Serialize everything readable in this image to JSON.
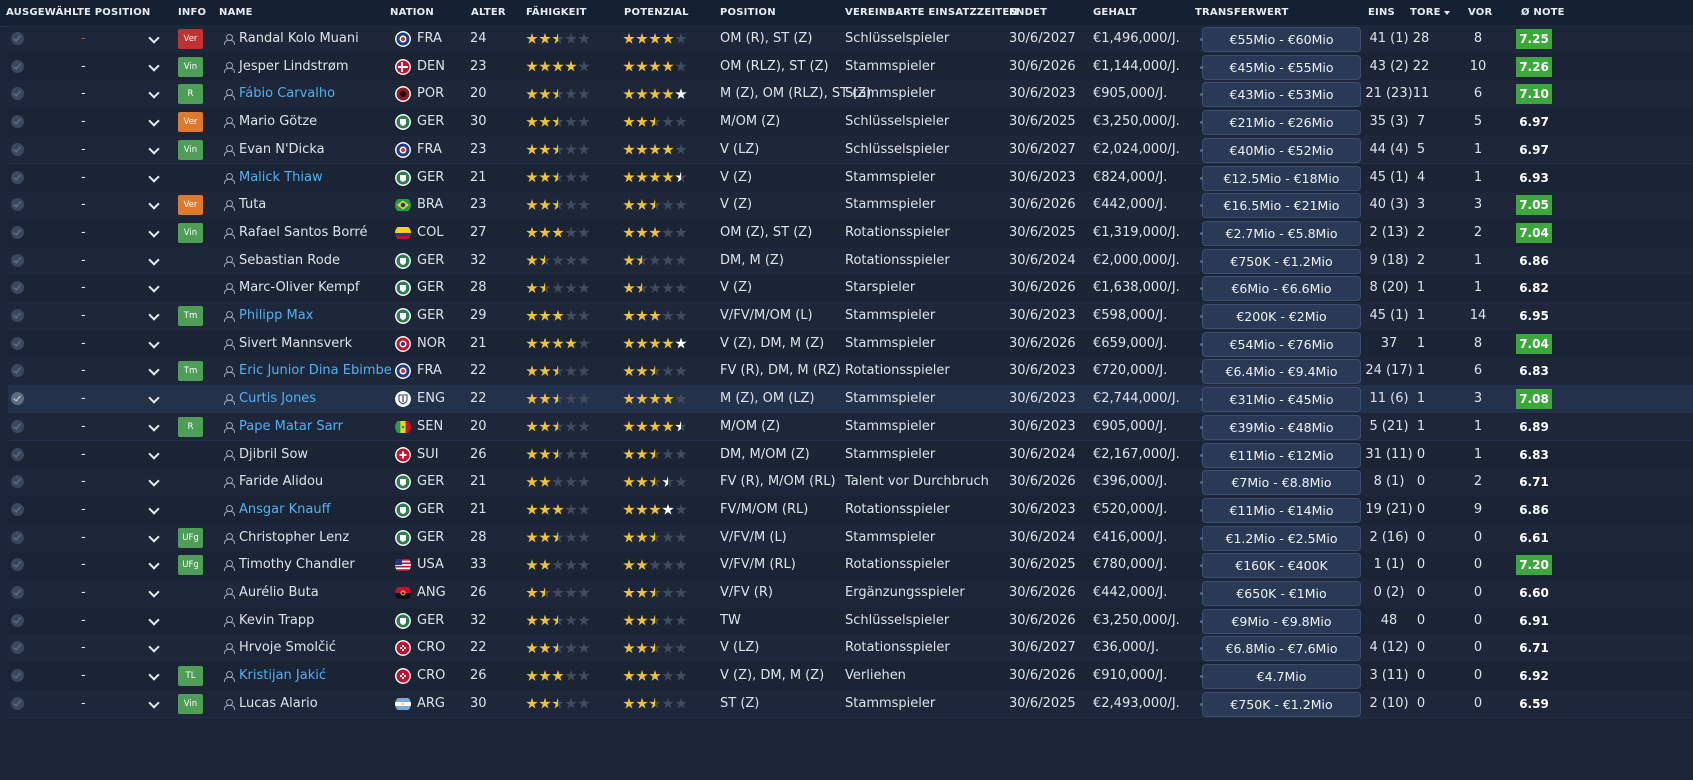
{
  "headers": {
    "sel_pos": "AUSGEWÄHLTE POSITION",
    "info": "INFO",
    "name": "NAME",
    "nation": "NATION",
    "age": "ALTER",
    "ability": "FÄHIGKEIT",
    "potential": "POTENZIAL",
    "position": "POSITION",
    "playing_time": "VEREINBARTE EINSATZZEITEN",
    "ends": "ENDET",
    "salary": "GEHALT",
    "transfer": "TRANSFERWERT",
    "apps": "EINS",
    "goals": "TORE",
    "assists": "VOR",
    "rating": "Ø NOTE"
  },
  "colors": {
    "badge_ver_red": "#c0312f",
    "badge_ver_orange": "#de7a2e",
    "badge_green": "#4f9e58",
    "note_green": "#3ca83c",
    "link": "#4fb2f0"
  },
  "players": [
    {
      "dash": "-",
      "dash_color": "red",
      "badge": "Ver",
      "badge_color": "#c0312f",
      "name": "Randal Kolo Muani",
      "link": false,
      "nation": "FRA",
      "age": "24",
      "ability": [
        2,
        2,
        1,
        0,
        0
      ],
      "potential": [
        2,
        2,
        2,
        2,
        0
      ],
      "position": "OM (R), ST (Z)",
      "playing": "Schlüsselspieler",
      "ends": "30/6/2027",
      "salary": "€1,496,000/J.",
      "transfer": "€55Mio - €60Mio",
      "apps": "41 (1)",
      "goals": "28",
      "assists": "8",
      "note": "7.25",
      "note_green": true
    },
    {
      "dash": "-",
      "badge": "Vin",
      "badge_color": "#4f9e58",
      "name": "Jesper Lindstrøm",
      "link": false,
      "nation": "DEN",
      "age": "23",
      "ability": [
        2,
        2,
        2,
        2,
        0
      ],
      "potential": [
        2,
        2,
        2,
        2,
        0
      ],
      "position": "OM (RLZ), ST (Z)",
      "playing": "Stammspieler",
      "ends": "30/6/2026",
      "salary": "€1,144,000/J.",
      "transfer": "€45Mio - €55Mio",
      "apps": "43 (2)",
      "goals": "22",
      "assists": "10",
      "note": "7.26",
      "note_green": true
    },
    {
      "dash": "-",
      "badge": "R",
      "badge_color": "#4f9e58",
      "name": "Fábio Carvalho",
      "link": true,
      "nation": "POR",
      "age": "20",
      "ability": [
        2,
        2,
        1,
        0,
        0
      ],
      "potential": [
        2,
        2,
        2,
        2,
        3
      ],
      "position": "M (Z), OM (RLZ), ST (Z)",
      "playing": "Stammspieler",
      "ends": "30/6/2023",
      "salary": "€905,000/J.",
      "transfer": "€43Mio - €53Mio",
      "apps": "21 (23)",
      "goals": "11",
      "assists": "6",
      "note": "7.10",
      "note_green": true
    },
    {
      "dash": "-",
      "badge": "Ver",
      "badge_color": "#de7a2e",
      "name": "Mario Götze",
      "link": false,
      "nation": "GER",
      "age": "30",
      "ability": [
        2,
        2,
        1,
        0,
        0
      ],
      "potential": [
        2,
        2,
        1,
        0,
        0
      ],
      "position": "M/OM (Z)",
      "playing": "Schlüsselspieler",
      "ends": "30/6/2025",
      "salary": "€3,250,000/J.",
      "transfer": "€21Mio - €26Mio",
      "apps": "35 (3)",
      "goals": "7",
      "assists": "5",
      "note": "6.97",
      "note_green": false
    },
    {
      "dash": "-",
      "badge": "Vin",
      "badge_color": "#4f9e58",
      "name": "Evan N'Dicka",
      "link": false,
      "nation": "FRA",
      "age": "23",
      "ability": [
        2,
        2,
        1,
        0,
        0
      ],
      "potential": [
        2,
        2,
        2,
        2,
        0
      ],
      "position": "V (LZ)",
      "playing": "Schlüsselspieler",
      "ends": "30/6/2027",
      "salary": "€2,024,000/J.",
      "transfer": "€40Mio - €52Mio",
      "apps": "44 (4)",
      "goals": "5",
      "assists": "1",
      "note": "6.97",
      "note_green": false
    },
    {
      "dash": "-",
      "badge": "",
      "name": "Malick Thiaw",
      "link": true,
      "nation": "GER",
      "age": "21",
      "ability": [
        2,
        2,
        1,
        0,
        0
      ],
      "potential": [
        2,
        2,
        2,
        2,
        4
      ],
      "position": "V (Z)",
      "playing": "Stammspieler",
      "ends": "30/6/2023",
      "salary": "€824,000/J.",
      "transfer": "€12.5Mio - €18Mio",
      "apps": "45 (1)",
      "goals": "4",
      "assists": "1",
      "note": "6.93",
      "note_green": false
    },
    {
      "dash": "-",
      "badge": "Ver",
      "badge_color": "#de7a2e",
      "name": "Tuta",
      "link": false,
      "nation": "BRA",
      "age": "23",
      "ability": [
        2,
        2,
        1,
        0,
        0
      ],
      "potential": [
        2,
        2,
        1,
        0,
        0
      ],
      "position": "V (Z)",
      "playing": "Stammspieler",
      "ends": "30/6/2026",
      "salary": "€442,000/J.",
      "transfer": "€16.5Mio - €21Mio",
      "apps": "40 (3)",
      "goals": "3",
      "assists": "3",
      "note": "7.05",
      "note_green": true
    },
    {
      "dash": "-",
      "badge": "Vin",
      "badge_color": "#4f9e58",
      "name": "Rafael Santos Borré",
      "link": false,
      "nation": "COL",
      "age": "27",
      "ability": [
        2,
        2,
        2,
        0,
        0
      ],
      "potential": [
        2,
        2,
        2,
        0,
        0
      ],
      "position": "OM (Z), ST (Z)",
      "playing": "Rotationsspieler",
      "ends": "30/6/2025",
      "salary": "€1,319,000/J.",
      "transfer": "€2.7Mio - €5.8Mio",
      "apps": "2 (13)",
      "goals": "2",
      "assists": "2",
      "note": "7.04",
      "note_green": true
    },
    {
      "dash": "-",
      "badge": "",
      "name": "Sebastian Rode",
      "link": false,
      "nation": "GER",
      "age": "32",
      "ability": [
        2,
        1,
        0,
        0,
        0
      ],
      "potential": [
        2,
        1,
        0,
        0,
        0
      ],
      "position": "DM, M (Z)",
      "playing": "Rotationsspieler",
      "ends": "30/6/2024",
      "salary": "€2,000,000/J.",
      "transfer": "€750K - €1.2Mio",
      "apps": "9 (18)",
      "goals": "2",
      "assists": "1",
      "note": "6.86",
      "note_green": false
    },
    {
      "dash": "-",
      "badge": "",
      "name": "Marc-Oliver Kempf",
      "link": false,
      "nation": "GER",
      "age": "28",
      "ability": [
        2,
        1,
        0,
        0,
        0
      ],
      "potential": [
        2,
        1,
        0,
        0,
        0
      ],
      "position": "V (Z)",
      "playing": "Starspieler",
      "ends": "30/6/2026",
      "salary": "€1,638,000/J.",
      "transfer": "€6Mio - €6.6Mio",
      "apps": "8 (20)",
      "goals": "1",
      "assists": "1",
      "note": "6.82",
      "note_green": false
    },
    {
      "dash": "-",
      "badge": "Tm",
      "badge_color": "#4f9e58",
      "name": "Philipp Max",
      "link": true,
      "nation": "GER",
      "age": "29",
      "ability": [
        2,
        2,
        2,
        0,
        0
      ],
      "potential": [
        2,
        2,
        2,
        0,
        0
      ],
      "position": "V/FV/M/OM (L)",
      "playing": "Stammspieler",
      "ends": "30/6/2023",
      "salary": "€598,000/J.",
      "transfer": "€200K - €2Mio",
      "apps": "45 (1)",
      "goals": "1",
      "assists": "14",
      "note": "6.95",
      "note_green": false
    },
    {
      "dash": "-",
      "badge": "",
      "name": "Sivert Mannsverk",
      "link": false,
      "nation": "NOR",
      "age": "21",
      "ability": [
        2,
        2,
        2,
        2,
        0
      ],
      "potential": [
        2,
        2,
        2,
        2,
        3
      ],
      "position": "V (Z), DM, M (Z)",
      "playing": "Stammspieler",
      "ends": "30/6/2026",
      "salary": "€659,000/J.",
      "transfer": "€54Mio - €76Mio",
      "apps": "37",
      "goals": "1",
      "assists": "8",
      "note": "7.04",
      "note_green": true
    },
    {
      "dash": "-",
      "badge": "Tm",
      "badge_color": "#4f9e58",
      "name": "Eric Junior Dina Ebimbe",
      "link": true,
      "nation": "FRA",
      "age": "22",
      "ability": [
        2,
        2,
        1,
        0,
        0
      ],
      "potential": [
        2,
        2,
        1,
        0,
        0
      ],
      "position": "FV (R), DM, M (RZ)",
      "playing": "Rotationsspieler",
      "ends": "30/6/2023",
      "salary": "€720,000/J.",
      "transfer": "€6.4Mio - €9.4Mio",
      "apps": "24 (17)",
      "goals": "1",
      "assists": "6",
      "note": "6.83",
      "note_green": false
    },
    {
      "dash": "-",
      "badge": "",
      "name": "Curtis Jones",
      "link": true,
      "selected": true,
      "nation": "ENG",
      "age": "22",
      "ability": [
        2,
        2,
        1,
        0,
        0
      ],
      "potential": [
        2,
        2,
        2,
        2,
        0
      ],
      "position": "M (Z), OM (LZ)",
      "playing": "Stammspieler",
      "ends": "30/6/2023",
      "salary": "€2,744,000/J.",
      "transfer": "€31Mio - €45Mio",
      "apps": "11 (6)",
      "goals": "1",
      "assists": "3",
      "note": "7.08",
      "note_green": true
    },
    {
      "dash": "-",
      "badge": "R",
      "badge_color": "#4f9e58",
      "name": "Pape Matar Sarr",
      "link": true,
      "nation": "SEN",
      "age": "20",
      "ability": [
        2,
        2,
        1,
        0,
        0
      ],
      "potential": [
        2,
        2,
        2,
        2,
        4
      ],
      "position": "M/OM (Z)",
      "playing": "Stammspieler",
      "ends": "30/6/2023",
      "salary": "€905,000/J.",
      "transfer": "€39Mio - €48Mio",
      "apps": "5 (21)",
      "goals": "1",
      "assists": "1",
      "note": "6.89",
      "note_green": false
    },
    {
      "dash": "-",
      "badge": "",
      "name": "Djibril Sow",
      "link": false,
      "nation": "SUI",
      "age": "26",
      "ability": [
        2,
        2,
        1,
        0,
        0
      ],
      "potential": [
        2,
        2,
        1,
        0,
        0
      ],
      "position": "DM, M/OM (Z)",
      "playing": "Stammspieler",
      "ends": "30/6/2024",
      "salary": "€2,167,000/J.",
      "transfer": "€11Mio - €12Mio",
      "apps": "31 (11)",
      "goals": "0",
      "assists": "1",
      "note": "6.83",
      "note_green": false
    },
    {
      "dash": "-",
      "badge": "",
      "name": "Faride Alidou",
      "link": false,
      "nation": "GER",
      "age": "21",
      "ability": [
        2,
        2,
        0,
        0,
        0
      ],
      "potential": [
        2,
        2,
        1,
        4,
        0
      ],
      "position": "FV (R), M/OM (RL)",
      "playing": "Talent vor Durchbruch",
      "ends": "30/6/2026",
      "salary": "€396,000/J.",
      "transfer": "€7Mio - €8.8Mio",
      "apps": "8 (1)",
      "goals": "0",
      "assists": "2",
      "note": "6.71",
      "note_green": false
    },
    {
      "dash": "-",
      "badge": "",
      "name": "Ansgar Knauff",
      "link": true,
      "nation": "GER",
      "age": "21",
      "ability": [
        2,
        2,
        2,
        0,
        0
      ],
      "potential": [
        2,
        2,
        2,
        3,
        0
      ],
      "position": "FV/M/OM (RL)",
      "playing": "Rotationsspieler",
      "ends": "30/6/2023",
      "salary": "€520,000/J.",
      "transfer": "€11Mio - €14Mio",
      "apps": "19 (21)",
      "goals": "0",
      "assists": "9",
      "note": "6.86",
      "note_green": false
    },
    {
      "dash": "-",
      "badge": "UFg",
      "badge_color": "#4f9e58",
      "name": "Christopher Lenz",
      "link": false,
      "nation": "GER",
      "age": "28",
      "ability": [
        2,
        2,
        1,
        0,
        0
      ],
      "potential": [
        2,
        2,
        1,
        0,
        0
      ],
      "position": "V/FV/M (L)",
      "playing": "Stammspieler",
      "ends": "30/6/2024",
      "salary": "€416,000/J.",
      "transfer": "€1.2Mio - €2.5Mio",
      "apps": "2 (16)",
      "goals": "0",
      "assists": "0",
      "note": "6.61",
      "note_green": false
    },
    {
      "dash": "-",
      "badge": "UFg",
      "badge_color": "#4f9e58",
      "name": "Timothy Chandler",
      "link": false,
      "nation": "USA",
      "age": "33",
      "ability": [
        2,
        2,
        0,
        0,
        0
      ],
      "potential": [
        2,
        2,
        0,
        0,
        0
      ],
      "position": "V/FV/M (RL)",
      "playing": "Rotationsspieler",
      "ends": "30/6/2025",
      "salary": "€780,000/J.",
      "transfer": "€160K - €400K",
      "apps": "1 (1)",
      "goals": "0",
      "assists": "0",
      "note": "7.20",
      "note_green": true
    },
    {
      "dash": "-",
      "badge": "",
      "name": "Aurélio Buta",
      "link": false,
      "nation": "ANG",
      "age": "26",
      "ability": [
        2,
        1,
        0,
        0,
        0
      ],
      "potential": [
        2,
        2,
        1,
        0,
        0
      ],
      "position": "V/FV (R)",
      "playing": "Ergänzungsspieler",
      "ends": "30/6/2026",
      "salary": "€442,000/J.",
      "transfer": "€650K - €1Mio",
      "apps": "0 (2)",
      "goals": "0",
      "assists": "0",
      "note": "6.60",
      "note_green": false
    },
    {
      "dash": "-",
      "badge": "",
      "name": "Kevin Trapp",
      "link": false,
      "nation": "GER",
      "age": "32",
      "ability": [
        2,
        2,
        1,
        0,
        0
      ],
      "potential": [
        2,
        2,
        1,
        0,
        0
      ],
      "position": "TW",
      "playing": "Schlüsselspieler",
      "ends": "30/6/2026",
      "salary": "€3,250,000/J.",
      "transfer": "€9Mio - €9.8Mio",
      "apps": "48",
      "goals": "0",
      "assists": "0",
      "note": "6.91",
      "note_green": false
    },
    {
      "dash": "-",
      "badge": "",
      "name": "Hrvoje Smolčić",
      "link": false,
      "nation": "CRO",
      "age": "22",
      "ability": [
        2,
        2,
        1,
        0,
        0
      ],
      "potential": [
        2,
        2,
        1,
        0,
        0
      ],
      "position": "V (LZ)",
      "playing": "Rotationsspieler",
      "ends": "30/6/2027",
      "salary": "€36,000/J.",
      "transfer": "€6.8Mio - €7.6Mio",
      "apps": "4 (12)",
      "goals": "0",
      "assists": "0",
      "note": "6.71",
      "note_green": false
    },
    {
      "dash": "-",
      "badge": "TL",
      "badge_color": "#4f9e58",
      "name": "Kristijan Jakić",
      "link": true,
      "nation": "CRO",
      "age": "26",
      "ability": [
        2,
        2,
        2,
        0,
        0
      ],
      "potential": [
        2,
        2,
        2,
        0,
        0
      ],
      "position": "V (Z), DM, M (Z)",
      "playing": "Verliehen",
      "ends": "30/6/2026",
      "salary": "€910,000/J.",
      "transfer": "€4.7Mio",
      "apps": "3 (11)",
      "goals": "0",
      "assists": "0",
      "note": "6.92",
      "note_green": false
    },
    {
      "dash": "-",
      "badge": "Vin",
      "badge_color": "#4f9e58",
      "name": "Lucas Alario",
      "link": false,
      "nation": "ARG",
      "age": "30",
      "ability": [
        2,
        2,
        1,
        0,
        0
      ],
      "potential": [
        2,
        2,
        1,
        0,
        0
      ],
      "position": "ST (Z)",
      "playing": "Stammspieler",
      "ends": "30/6/2025",
      "salary": "€2,493,000/J.",
      "transfer": "€750K - €1.2Mio",
      "apps": "2 (10)",
      "goals": "0",
      "assists": "0",
      "note": "6.59",
      "note_green": false
    }
  ]
}
